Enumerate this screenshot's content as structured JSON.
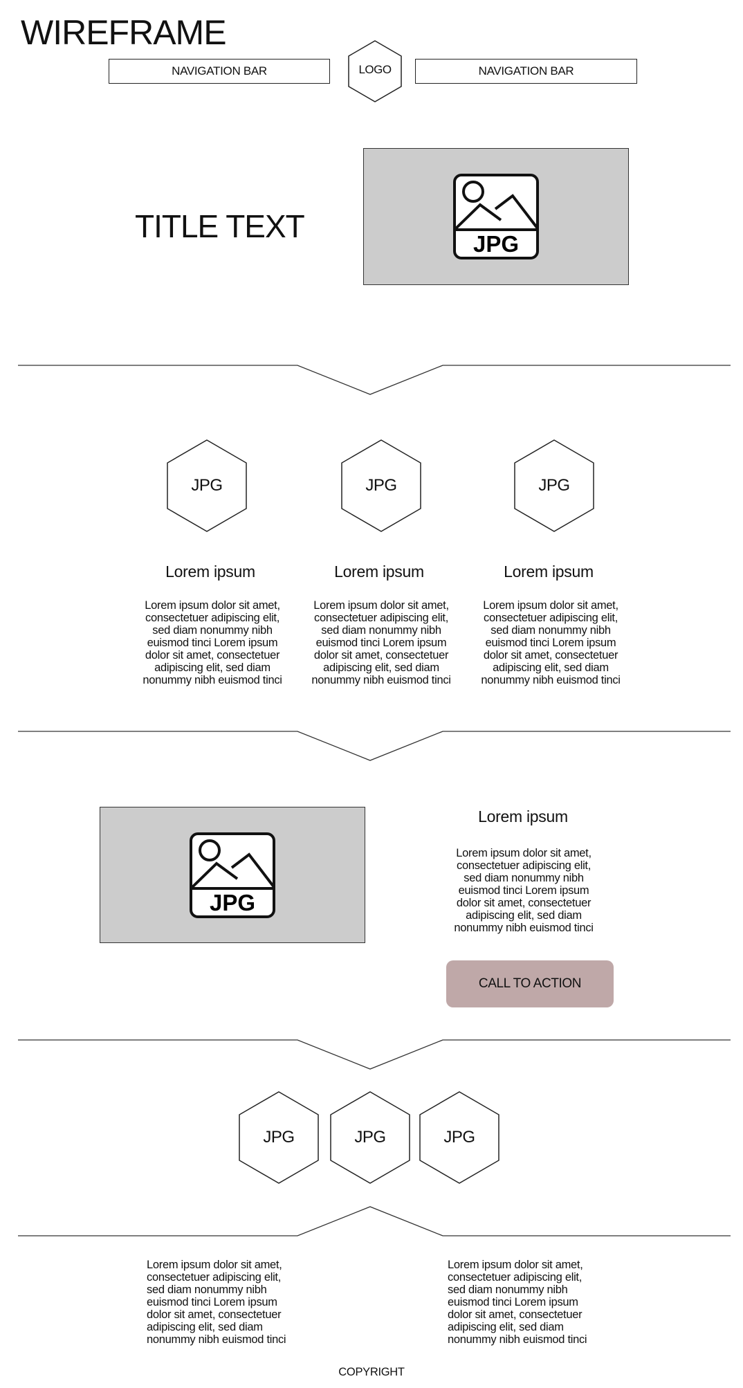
{
  "header": {
    "heading": "WIREFRAME",
    "nav_left": "NAVIGATION BAR",
    "logo": "LOGO",
    "nav_right": "NAVIGATION BAR"
  },
  "hero": {
    "title": "TITLE TEXT",
    "image_label": "JPG",
    "image_icon": "jpg-image-icon"
  },
  "features": [
    {
      "image_label": "JPG",
      "title": "Lorem ipsum",
      "body": "Lorem ipsum dolor sit amet,\nconsectetuer adipiscing elit,\nsed diam nonummy nibh\neuismod tinci Lorem ipsum\ndolor sit amet, consectetuer\nadipiscing elit, sed diam\nnonummy nibh euismod tinci"
    },
    {
      "image_label": "JPG",
      "title": "Lorem ipsum",
      "body": "Lorem ipsum dolor sit amet,\nconsectetuer adipiscing elit,\nsed diam nonummy nibh\neuismod tinci Lorem ipsum\ndolor sit amet, consectetuer\nadipiscing elit, sed diam\nnonummy nibh euismod tinci"
    },
    {
      "image_label": "JPG",
      "title": "Lorem ipsum",
      "body": "Lorem ipsum dolor sit amet,\nconsectetuer adipiscing elit,\nsed diam nonummy nibh\neuismod tinci Lorem ipsum\ndolor sit amet, consectetuer\nadipiscing elit, sed diam\nnonummy nibh euismod tinci"
    }
  ],
  "promo": {
    "image_label": "JPG",
    "title": "Lorem ipsum",
    "body": "Lorem ipsum dolor sit amet,\nconsectetuer adipiscing elit,\nsed diam nonummy nibh\neuismod tinci Lorem ipsum\ndolor sit amet, consectetuer\nadipiscing elit, sed diam\nnonummy nibh euismod tinci",
    "cta_label": "CALL TO ACTION",
    "cta_color": "#bfa8a8"
  },
  "gallery": [
    "JPG",
    "JPG",
    "JPG"
  ],
  "footer": {
    "left_text": "Lorem ipsum dolor sit amet,\nconsectetuer adipiscing elit,\nsed diam nonummy nibh\neuismod tinci Lorem ipsum\ndolor sit amet, consectetuer\nadipiscing elit, sed diam\nnonummy nibh euismod tinci",
    "right_text": "Lorem ipsum dolor sit amet,\nconsectetuer adipiscing elit,\nsed diam nonummy nibh\neuismod tinci Lorem ipsum\ndolor sit amet, consectetuer\nadipiscing elit, sed diam\nnonummy nibh euismod tinci",
    "copyright": "COPYRIGHT"
  },
  "colors": {
    "image_placeholder": "#cccccc",
    "line": "#333333"
  }
}
